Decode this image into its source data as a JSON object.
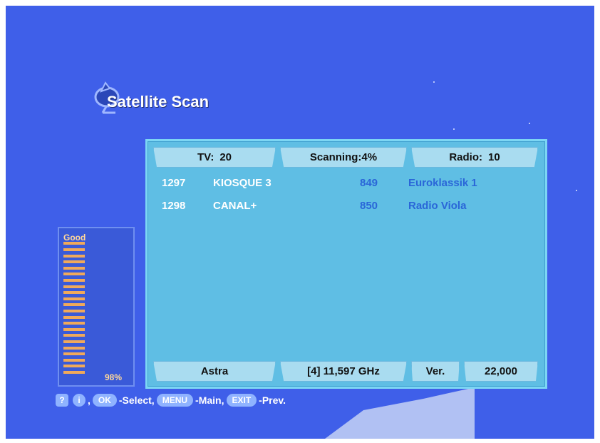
{
  "screen": {
    "title": "Satellite Scan"
  },
  "scan_header": {
    "tv_label": "TV:",
    "tv_count": "20",
    "scanning_text": "Scanning:4%",
    "radio_label": "Radio:",
    "radio_count": "10"
  },
  "tv_channels": [
    {
      "number": "1297",
      "name": "KIOSQUE 3"
    },
    {
      "number": "1298",
      "name": "CANAL+"
    }
  ],
  "radio_channels": [
    {
      "number": "849",
      "name": "Euroklassik 1"
    },
    {
      "number": "850",
      "name": "Radio Viola"
    }
  ],
  "signal": {
    "label": "Good",
    "percent_text": "98%",
    "level": 0.98
  },
  "footer": {
    "satellite": "Astra",
    "frequency": "[4] 11,597 GHz",
    "polarization": "Ver.",
    "symbol_rate": "22,000"
  },
  "help_bar": {
    "help_icon": "?",
    "info_icon": "i",
    "comma": ",",
    "ok_key": "OK",
    "select_text": "-Select,",
    "menu_key": "MENU",
    "main_text": "-Main,",
    "exit_key": "EXIT",
    "prev_text": "-Prev."
  },
  "icons": {
    "title_icon": "satellite-dish-icon"
  },
  "colors": {
    "background": "#3f5fe9",
    "panel": "#5fbee4",
    "header_box": "#a9dcf0",
    "tv_text": "#ffffff",
    "radio_text": "#2a66d8",
    "signal_bar": "#f0a95a"
  }
}
